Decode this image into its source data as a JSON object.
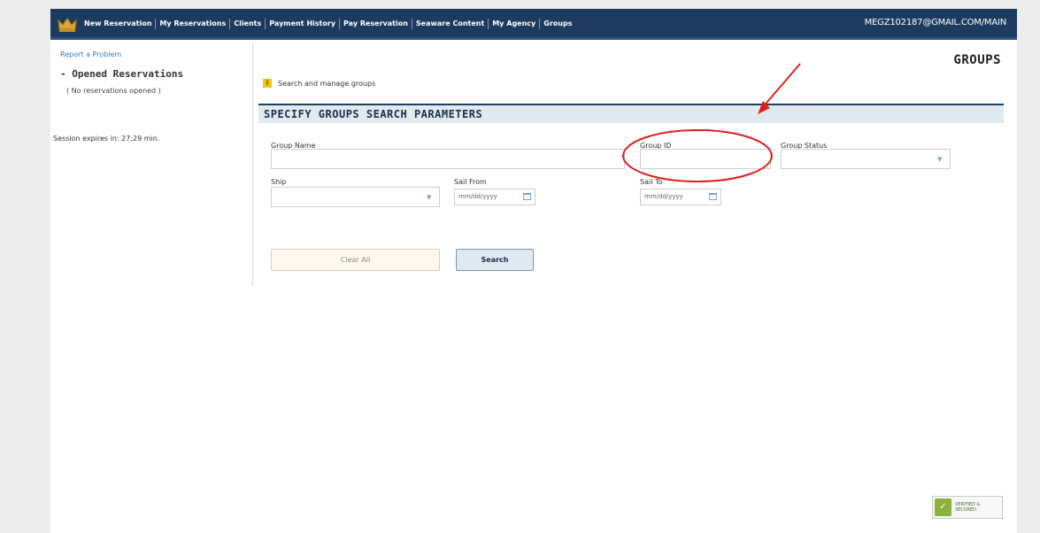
{
  "nav": {
    "items": [
      "New Reservation",
      "My Reservations",
      "Clients",
      "Payment History",
      "Pay Reservation",
      "Seaware Content",
      "My Agency",
      "Groups"
    ],
    "active": "Groups",
    "account": "MEGZ102187@GMAIL.COM/MAIN"
  },
  "sidebar": {
    "report": "Report a Problem",
    "opened_title": "- Opened Reservations",
    "no_reservations": "( No reservations opened )",
    "session": "Session expires in: 27:29 min."
  },
  "main": {
    "page_title": "GROUPS",
    "hint": "Search and manage groups",
    "section_title": "SPECIFY GROUPS SEARCH PARAMETERS"
  },
  "form": {
    "group_name_label": "Group Name",
    "group_id_label": "Group ID",
    "group_status_label": "Group Status",
    "ship_label": "Ship",
    "sail_from_label": "Sail From",
    "sail_to_label": "Sail To",
    "date_placeholder": "mm/dd/yyyy",
    "clear_label": "Clear All",
    "search_label": "Search"
  },
  "badge": {
    "text": "VERIFIED & SECURED",
    "color": "#8bb33b"
  },
  "annotation": {
    "color": "#e02020"
  }
}
